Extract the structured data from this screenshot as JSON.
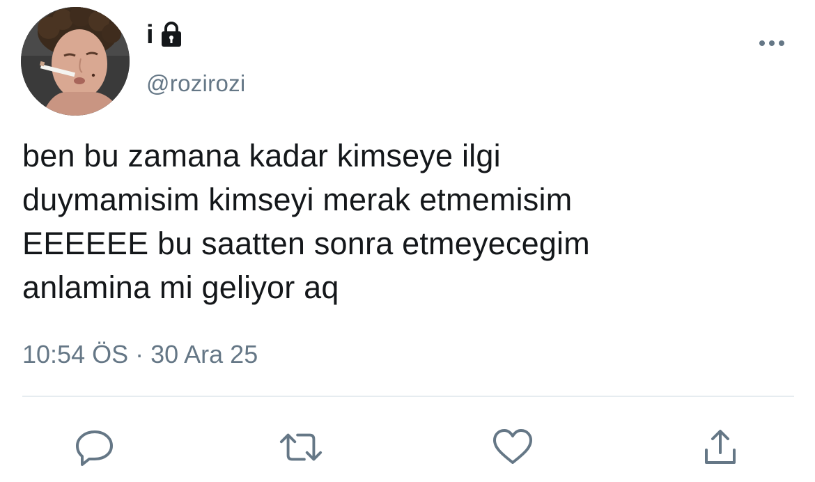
{
  "tweet": {
    "display_name": "i",
    "handle": "@rozirozi",
    "text_lines": [
      "ben bu zamana kadar kimseye ilgi",
      "duymamisim kimseyi merak etmemisim",
      "EEEEEE bu saatten sonra etmeyecegim",
      "anlamina mi geliyor aq"
    ],
    "timestamp": "10:54 ÖS · 30 Ara 25"
  },
  "icons": {
    "lock": "lock-icon",
    "more": "more-horizontal-icon",
    "reply": "reply-icon",
    "retweet": "retweet-icon",
    "like": "heart-icon",
    "share": "share-icon"
  },
  "colors": {
    "text": "#14171a",
    "secondary": "#657786",
    "divider": "#e6ecf0",
    "icon": "#657786"
  }
}
